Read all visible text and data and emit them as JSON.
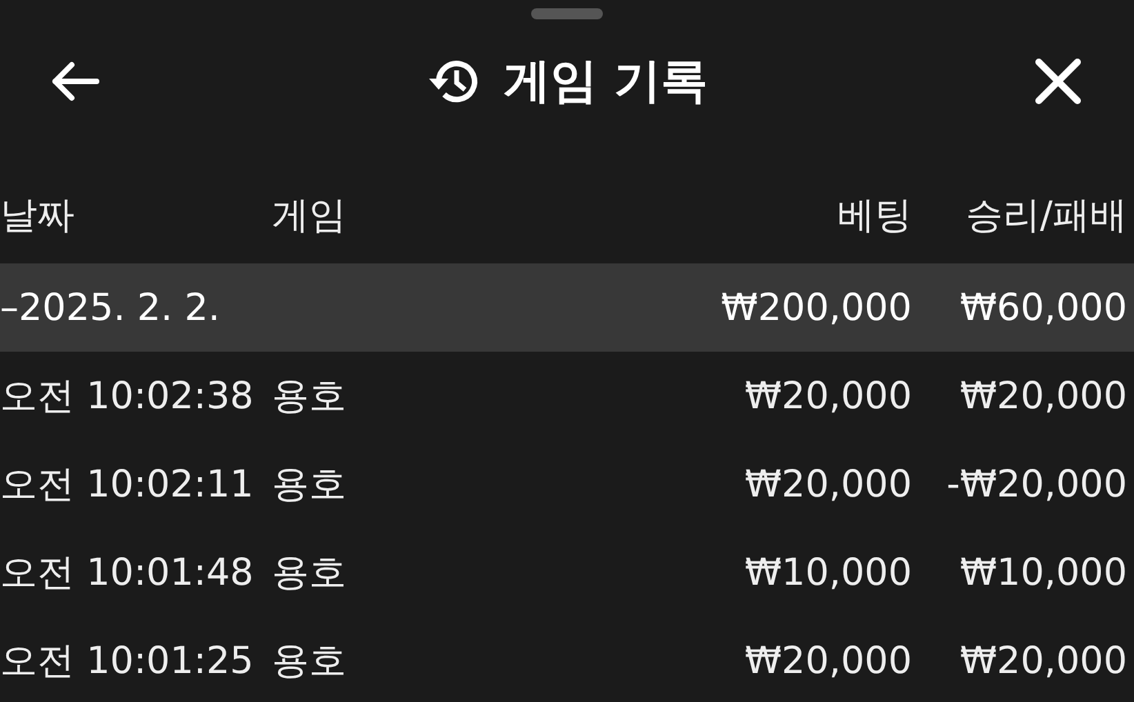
{
  "header": {
    "title": "게임 기록"
  },
  "table": {
    "columns": [
      "날짜",
      "게임",
      "베팅",
      "승리/패배"
    ],
    "groups": [
      {
        "date": "–2025. 2. 2.",
        "bet": "₩200,000",
        "result": "₩60,000",
        "expanded": true,
        "rows": [
          {
            "time": "오전 10:02:38",
            "game": "용호",
            "bet": "₩20,000",
            "result": "₩20,000"
          },
          {
            "time": "오전 10:02:11",
            "game": "용호",
            "bet": "₩20,000",
            "result": "-₩20,000"
          },
          {
            "time": "오전 10:01:48",
            "game": "용호",
            "bet": "₩10,000",
            "result": "₩10,000"
          },
          {
            "time": "오전 10:01:25",
            "game": "용호",
            "bet": "₩20,000",
            "result": "₩20,000"
          }
        ]
      }
    ]
  }
}
